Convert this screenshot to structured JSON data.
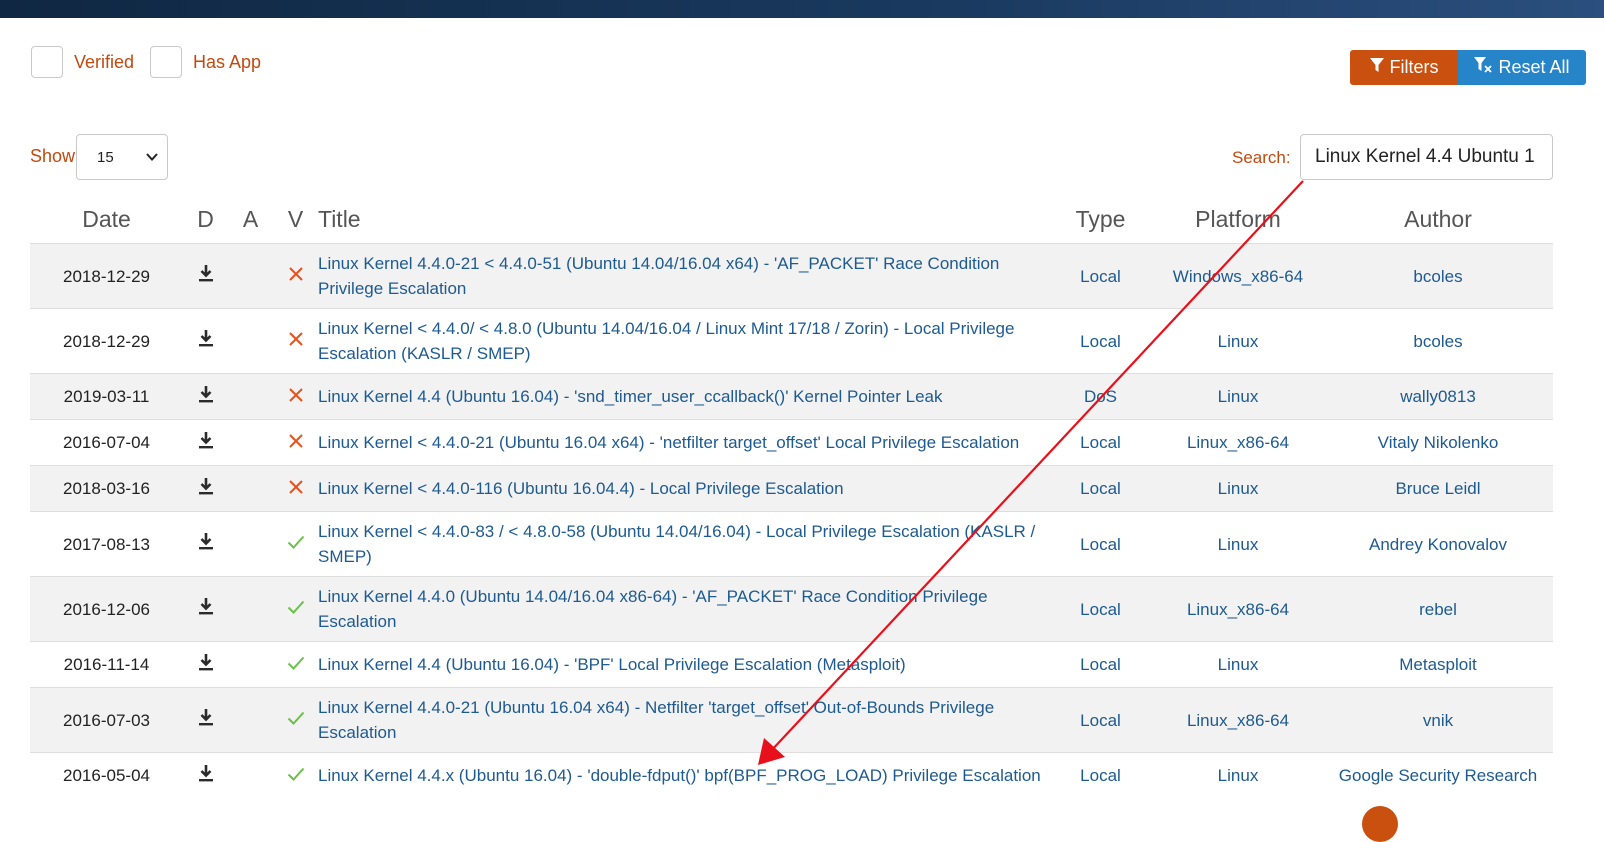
{
  "filters": {
    "verified_label": "Verified",
    "has_app_label": "Has App",
    "filters_button": "Filters",
    "reset_button": "Reset All"
  },
  "show": {
    "label": "Show",
    "value": "15"
  },
  "search": {
    "label": "Search:",
    "value": "Linux Kernel 4.4 Ubuntu 1"
  },
  "table": {
    "headers": [
      "Date",
      "D",
      "A",
      "V",
      "Title",
      "Type",
      "Platform",
      "Author"
    ],
    "rows": [
      {
        "date": "2018-12-29",
        "verified": false,
        "title": "Linux Kernel 4.4.0-21 < 4.4.0-51 (Ubuntu 14.04/16.04 x64) - 'AF_PACKET' Race Condition Privilege Escalation",
        "type": "Local",
        "platform": "Windows_x86-64",
        "author": "bcoles"
      },
      {
        "date": "2018-12-29",
        "verified": false,
        "title": "Linux Kernel < 4.4.0/ < 4.8.0 (Ubuntu 14.04/16.04 / Linux Mint 17/18 / Zorin) - Local Privilege Escalation (KASLR / SMEP)",
        "type": "Local",
        "platform": "Linux",
        "author": "bcoles"
      },
      {
        "date": "2019-03-11",
        "verified": false,
        "title": "Linux Kernel 4.4 (Ubuntu 16.04) - 'snd_timer_user_ccallback()' Kernel Pointer Leak",
        "type": "DoS",
        "platform": "Linux",
        "author": "wally0813"
      },
      {
        "date": "2016-07-04",
        "verified": false,
        "title": "Linux Kernel < 4.4.0-21 (Ubuntu 16.04 x64) - 'netfilter target_offset' Local Privilege Escalation",
        "type": "Local",
        "platform": "Linux_x86-64",
        "author": "Vitaly Nikolenko"
      },
      {
        "date": "2018-03-16",
        "verified": false,
        "title": "Linux Kernel < 4.4.0-116 (Ubuntu 16.04.4) - Local Privilege Escalation",
        "type": "Local",
        "platform": "Linux",
        "author": "Bruce Leidl"
      },
      {
        "date": "2017-08-13",
        "verified": true,
        "title": "Linux Kernel < 4.4.0-83 / < 4.8.0-58 (Ubuntu 14.04/16.04) - Local Privilege Escalation (KASLR / SMEP)",
        "type": "Local",
        "platform": "Linux",
        "author": "Andrey Konovalov"
      },
      {
        "date": "2016-12-06",
        "verified": true,
        "title": "Linux Kernel 4.4.0 (Ubuntu 14.04/16.04 x86-64) - 'AF_PACKET' Race Condition Privilege Escalation",
        "type": "Local",
        "platform": "Linux_x86-64",
        "author": "rebel"
      },
      {
        "date": "2016-11-14",
        "verified": true,
        "title": "Linux Kernel 4.4 (Ubuntu 16.04) - 'BPF' Local Privilege Escalation (Metasploit)",
        "type": "Local",
        "platform": "Linux",
        "author": "Metasploit"
      },
      {
        "date": "2016-07-03",
        "verified": true,
        "title": "Linux Kernel 4.4.0-21 (Ubuntu 16.04 x64) - Netfilter 'target_offset' Out-of-Bounds Privilege Escalation",
        "type": "Local",
        "platform": "Linux_x86-64",
        "author": "vnik"
      },
      {
        "date": "2016-05-04",
        "verified": true,
        "title": "Linux Kernel 4.4.x (Ubuntu 16.04) - 'double-fdput()' bpf(BPF_PROG_LOAD) Privilege Escalation",
        "type": "Local",
        "platform": "Linux",
        "author": "Google Security Research"
      }
    ]
  },
  "icons": {
    "download": "download-icon",
    "not_verified": "x-icon",
    "verified": "check-icon",
    "filter": "filter-icon",
    "reset": "filter-clear-icon"
  },
  "colors": {
    "accent_orange": "#c9500f",
    "accent_blue": "#2684c9",
    "link_blue": "#1d5a91",
    "cross_orange": "#e8501a",
    "check_green": "#6cbf4a",
    "annotation_red": "#e8101a"
  }
}
